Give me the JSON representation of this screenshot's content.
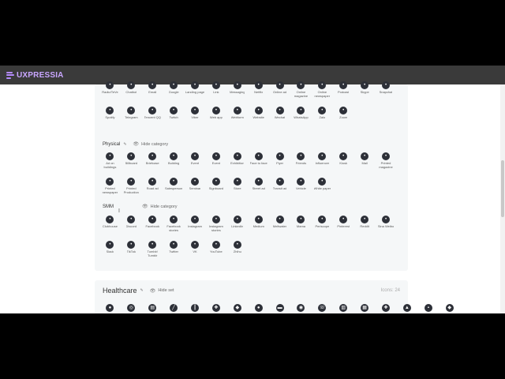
{
  "app": {
    "logo_text": "UXPRESSIA"
  },
  "panel1": {
    "rows_top": [
      {
        "items": [
          {
            "icon": "radio-icon",
            "label": "Radio/TeVe"
          },
          {
            "icon": "chatbot-icon",
            "label": "Chatbot"
          },
          {
            "icon": "email-icon",
            "label": "Email"
          },
          {
            "icon": "google-icon",
            "label": "Google"
          },
          {
            "icon": "landing-page-icon",
            "label": "Landing page"
          },
          {
            "icon": "link-icon",
            "label": "Link"
          },
          {
            "icon": "messaging-icon",
            "label": "Messaging"
          },
          {
            "icon": "netflix-icon",
            "label": "Netflix"
          },
          {
            "icon": "online-ad-icon",
            "label": "Online ad"
          },
          {
            "icon": "online-magazine-icon",
            "label": "Online magazine"
          },
          {
            "icon": "online-newspaper-icon",
            "label": "Online newspaper"
          },
          {
            "icon": "podcast-icon",
            "label": "Podcast"
          },
          {
            "icon": "skype-icon",
            "label": "Skype"
          },
          {
            "icon": "snapchat-icon",
            "label": "Snapchat"
          }
        ]
      },
      {
        "items": [
          {
            "icon": "spotify-icon",
            "label": "Spotify"
          },
          {
            "icon": "telegram-icon",
            "label": "Telegram"
          },
          {
            "icon": "tencent-qq-icon",
            "label": "Tencent QQ"
          },
          {
            "icon": "twitch-icon",
            "label": "Twitch"
          },
          {
            "icon": "viber-icon",
            "label": "Viber"
          },
          {
            "icon": "web-app-icon",
            "label": "Web app"
          },
          {
            "icon": "webform-icon",
            "label": "Webform"
          },
          {
            "icon": "website-icon",
            "label": "Website"
          },
          {
            "icon": "wechat-icon",
            "label": "Wechat"
          },
          {
            "icon": "whatsapp-icon",
            "label": "WhatsApp"
          },
          {
            "icon": "zalo-icon",
            "label": "Zalo"
          },
          {
            "icon": "zoom-icon",
            "label": "Zoom"
          }
        ]
      }
    ],
    "physical": {
      "title": "Physical",
      "hide_label": "Hide category",
      "rows": [
        {
          "items": [
            {
              "icon": "ad-on-buildings-icon",
              "label": "Ad on buildings"
            },
            {
              "icon": "billboard-icon",
              "label": "Billboard"
            },
            {
              "icon": "brief-case-icon",
              "label": "Briefcase"
            },
            {
              "icon": "building-icon",
              "label": "Building"
            },
            {
              "icon": "event-icon",
              "label": "Event"
            },
            {
              "icon": "event2-icon",
              "label": "Event"
            },
            {
              "icon": "exhibition-icon",
              "label": "Exhibition"
            },
            {
              "icon": "face-to-face-icon",
              "label": "Face to face"
            },
            {
              "icon": "flyer-icon",
              "label": "Flyer"
            },
            {
              "icon": "friends-icon",
              "label": "Friends"
            },
            {
              "icon": "influencer-icon",
              "label": "Influencer"
            },
            {
              "icon": "kiosk-icon",
              "label": "Kiosk"
            },
            {
              "icon": "mail-icon",
              "label": "Mail"
            },
            {
              "icon": "printed-magazine-icon",
              "label": "Printed magazine"
            }
          ]
        },
        {
          "items": [
            {
              "icon": "printed-newspaper-icon",
              "label": "Printed newspaper"
            },
            {
              "icon": "printed-production-icon",
              "label": "Printed Production"
            },
            {
              "icon": "road-ad-icon",
              "label": "Road ad"
            },
            {
              "icon": "salesperson-icon",
              "label": "Salesperson"
            },
            {
              "icon": "seminar-icon",
              "label": "Seminar"
            },
            {
              "icon": "signboard-icon",
              "label": "Signboard"
            },
            {
              "icon": "store-icon",
              "label": "Store"
            },
            {
              "icon": "street-ad-icon",
              "label": "Street ad"
            },
            {
              "icon": "transit-ad-icon",
              "label": "Transit ad"
            },
            {
              "icon": "vehicle-icon",
              "label": "Vehicle"
            },
            {
              "icon": "white-paper-icon",
              "label": "White paper"
            }
          ]
        }
      ]
    },
    "smm": {
      "title": "SMM",
      "hide_label": "Hide category",
      "rows": [
        {
          "items": [
            {
              "icon": "clubhouse-icon",
              "label": "Clubhouse"
            },
            {
              "icon": "discord-icon",
              "label": "Discord"
            },
            {
              "icon": "facebook-icon",
              "label": "Facebook"
            },
            {
              "icon": "facebook-stories-icon",
              "label": "Facebook stories"
            },
            {
              "icon": "instagram-icon",
              "label": "Instagram"
            },
            {
              "icon": "instagram-stories-icon",
              "label": "Instagram stories"
            },
            {
              "icon": "linkedin-icon",
              "label": "LinkedIn"
            },
            {
              "icon": "medium-icon",
              "label": "Medium"
            },
            {
              "icon": "meltwater-icon",
              "label": "Meltwater"
            },
            {
              "icon": "mastodon-icon",
              "label": "Mama"
            },
            {
              "icon": "periscope-icon",
              "label": "Periscope"
            },
            {
              "icon": "pinterest-icon",
              "label": "Pinterest"
            },
            {
              "icon": "reddit-icon",
              "label": "Reddit"
            },
            {
              "icon": "sina-weibo-icon",
              "label": "Sina Weibo"
            }
          ]
        },
        {
          "items": [
            {
              "icon": "slack-icon",
              "label": "Slack"
            },
            {
              "icon": "tiktok-icon",
              "label": "TikTok"
            },
            {
              "icon": "tumblr-icon",
              "label": "Tumblr/ Tumblr"
            },
            {
              "icon": "twitter-icon",
              "label": "Twitter"
            },
            {
              "icon": "vk-icon",
              "label": "VK"
            },
            {
              "icon": "youtube-icon",
              "label": "YouTube"
            },
            {
              "icon": "zhihu-icon",
              "label": "Zhihu"
            }
          ]
        }
      ]
    }
  },
  "healthcare": {
    "title": "Healthcare",
    "hide_label": "Hide set",
    "count": "Icons: 24",
    "icons": [
      "person-icon",
      "stethoscope-icon",
      "clipboard-icon",
      "syringe-icon",
      "thermometer-icon",
      "bandage-icon",
      "drop-icon",
      "doctor-icon",
      "ambulance-icon",
      "pill-icon",
      "phone-icon",
      "chart-icon",
      "report-icon",
      "hospital-icon",
      "microscope-icon",
      "medkit-icon",
      "shield-icon"
    ]
  },
  "glyphs": {
    "pencil": "✎",
    "eye": "👁",
    "cursor": "I"
  }
}
